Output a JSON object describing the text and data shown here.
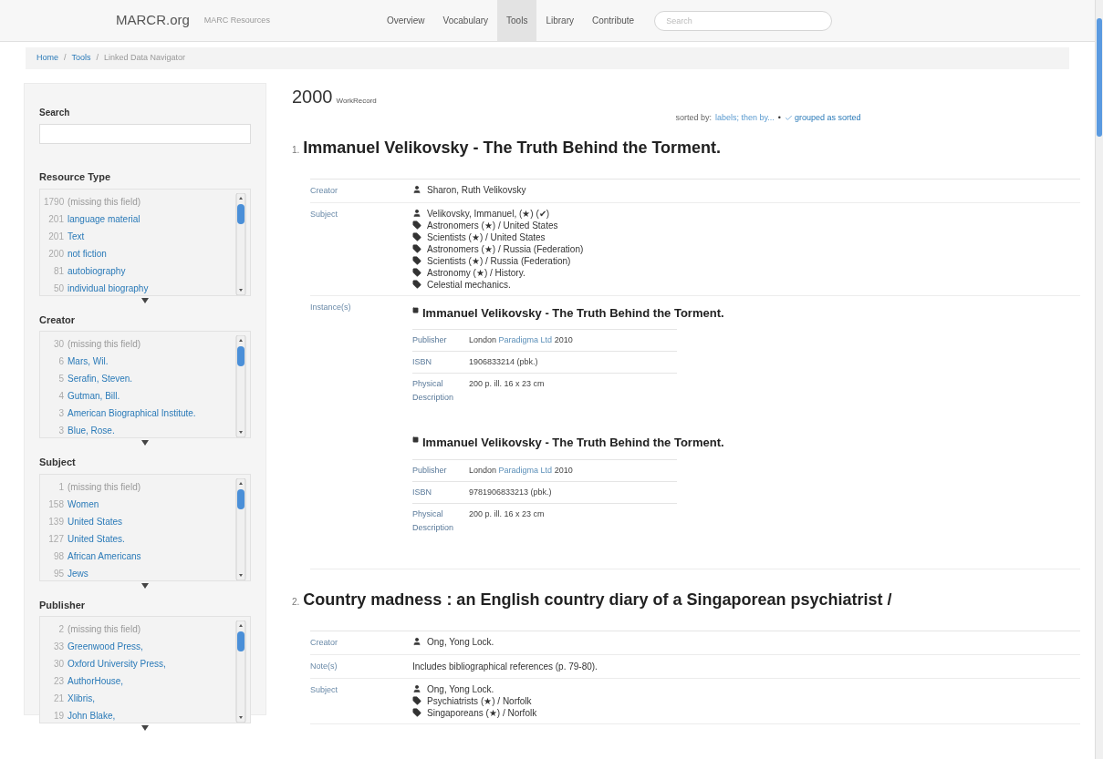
{
  "navbar": {
    "brand": "MARCR.org",
    "tagline": "MARC Resources",
    "links": [
      {
        "label": "Overview",
        "selected": false
      },
      {
        "label": "Vocabulary",
        "selected": false
      },
      {
        "label": "Tools",
        "selected": true
      },
      {
        "label": "Library",
        "selected": false
      },
      {
        "label": "Contribute",
        "selected": false
      }
    ],
    "search": {
      "placeholder": "Search"
    }
  },
  "breadcrumb_separator": "/",
  "breadcrumb": [
    {
      "label": "Home",
      "kind": "link"
    },
    {
      "label": "Tools",
      "kind": "link"
    },
    {
      "label": "Linked Data Navigator",
      "kind": "current"
    }
  ],
  "sidebar": {
    "search": {
      "label": "Search"
    },
    "facets": [
      {
        "title": "Resource Type",
        "items": [
          {
            "count": "1790",
            "label": "(missing this field)",
            "kind": "missing"
          },
          {
            "count": "201",
            "label": "language material",
            "kind": "value"
          },
          {
            "count": "201",
            "label": "Text",
            "kind": "value"
          },
          {
            "count": "200",
            "label": "not fiction",
            "kind": "value"
          },
          {
            "count": "81",
            "label": "autobiography",
            "kind": "value"
          },
          {
            "count": "50",
            "label": "individual biography",
            "kind": "value"
          }
        ]
      },
      {
        "title": "Creator",
        "items": [
          {
            "count": "30",
            "label": "(missing this field)",
            "kind": "missing"
          },
          {
            "count": "6",
            "label": "Mars, Wil.",
            "kind": "value"
          },
          {
            "count": "5",
            "label": "Serafin, Steven.",
            "kind": "value"
          },
          {
            "count": "4",
            "label": "Gutman, Bill.",
            "kind": "value"
          },
          {
            "count": "3",
            "label": "American Biographical Institute.",
            "kind": "value"
          },
          {
            "count": "3",
            "label": "Blue, Rose.",
            "kind": "value"
          }
        ]
      },
      {
        "title": "Subject",
        "items": [
          {
            "count": "1",
            "label": "(missing this field)",
            "kind": "missing"
          },
          {
            "count": "158",
            "label": "Women",
            "kind": "value"
          },
          {
            "count": "139",
            "label": "United States",
            "kind": "value"
          },
          {
            "count": "127",
            "label": "United States.",
            "kind": "value"
          },
          {
            "count": "98",
            "label": "African Americans",
            "kind": "value"
          },
          {
            "count": "95",
            "label": "Jews",
            "kind": "value"
          }
        ]
      },
      {
        "title": "Publisher",
        "items": [
          {
            "count": "2",
            "label": "(missing this field)",
            "kind": "missing"
          },
          {
            "count": "33",
            "label": "Greenwood Press,",
            "kind": "value"
          },
          {
            "count": "30",
            "label": "Oxford University Press,",
            "kind": "value"
          },
          {
            "count": "23",
            "label": "AuthorHouse,",
            "kind": "value"
          },
          {
            "count": "21",
            "label": "Xlibris,",
            "kind": "value"
          },
          {
            "count": "19",
            "label": "John Blake,",
            "kind": "value"
          }
        ]
      }
    ]
  },
  "results": {
    "count": "2000",
    "type": "WorkRecord",
    "sort": {
      "label": "sorted by:",
      "sort_link": "labels; then by...",
      "separator": "•",
      "grouped": {
        "label": "grouped as sorted",
        "checked": true
      }
    },
    "records": [
      {
        "number": "1.",
        "title": "Immanuel Velikovsky - The Truth Behind the Torment.",
        "fields": [
          {
            "label": "Creator",
            "kind": "entries",
            "entries": [
              {
                "kind": "person",
                "text": "Sharon, Ruth Velikovsky"
              }
            ]
          },
          {
            "label": "Subject",
            "kind": "entries",
            "entries": [
              {
                "kind": "person",
                "text": "Velikovsky, Immanuel, (★) (✔)"
              },
              {
                "kind": "tag",
                "text": "Astronomers (★) / United States"
              },
              {
                "kind": "tag",
                "text": "Scientists (★) / United States"
              },
              {
                "kind": "tag",
                "text": "Astronomers (★) / Russia (Federation)"
              },
              {
                "kind": "tag",
                "text": "Scientists (★) / Russia (Federation)"
              },
              {
                "kind": "tag",
                "text": "Astronomy (★) / History."
              },
              {
                "kind": "tag",
                "text": "Celestial mechanics."
              }
            ]
          },
          {
            "label": "Instance(s)",
            "kind": "instances",
            "instances": [
              {
                "title": "Immanuel Velikovsky - The Truth Behind the Torment.",
                "publisher": {
                  "place": "London",
                  "name": "Paradigma Ltd",
                  "year": "2010"
                },
                "isbn": "1906833214 (pbk.)",
                "physical": "200 p. ill. 16 x 23 cm",
                "labels": [
                  "Publisher",
                  "ISBN",
                  "Physical Description"
                ]
              },
              {
                "title": "Immanuel Velikovsky - The Truth Behind the Torment.",
                "publisher": {
                  "place": "London",
                  "name": "Paradigma Ltd",
                  "year": "2010"
                },
                "isbn": "9781906833213 (pbk.)",
                "physical": "200 p. ill. 16 x 23 cm",
                "labels": [
                  "Publisher",
                  "ISBN",
                  "Physical Description"
                ]
              }
            ]
          }
        ]
      },
      {
        "number": "2.",
        "title": "Country madness : an English country diary of a Singaporean psychiatrist /",
        "fields": [
          {
            "label": "Creator",
            "kind": "entries",
            "entries": [
              {
                "kind": "person",
                "text": "Ong, Yong Lock."
              }
            ]
          },
          {
            "label": "Note(s)",
            "kind": "text",
            "text": "Includes bibliographical references (p. 79-80)."
          },
          {
            "label": "Subject",
            "kind": "entries",
            "entries": [
              {
                "kind": "person",
                "text": "Ong, Yong Lock."
              },
              {
                "kind": "tag",
                "text": "Psychiatrists (★) / Norfolk"
              },
              {
                "kind": "tag",
                "text": "Singaporeans (★) / Norfolk"
              }
            ]
          }
        ]
      }
    ]
  }
}
